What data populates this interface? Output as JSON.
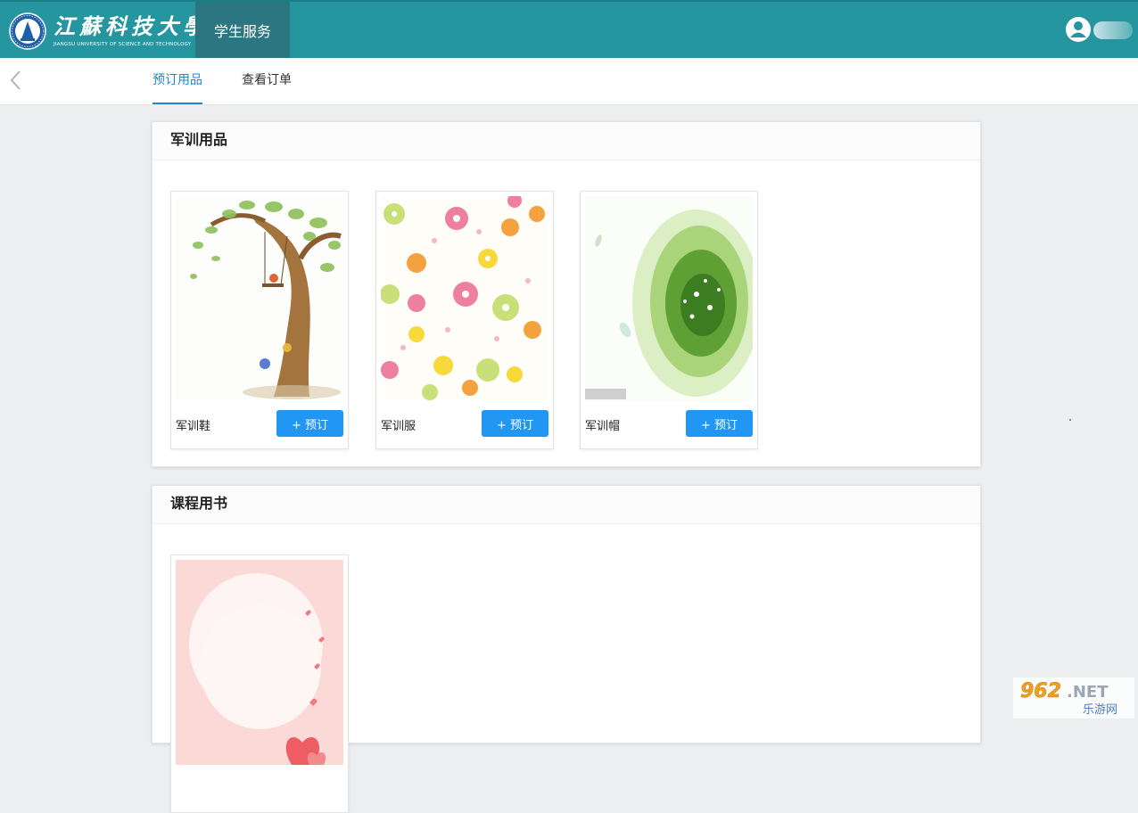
{
  "header": {
    "logo_cn": "江蘇科技大學",
    "logo_en": "JIANGSU UNIVERSITY OF SCIENCE AND TECHNOLOGY",
    "nav_item": "学生服务"
  },
  "tabs": [
    {
      "label": "预订用品",
      "active": true
    },
    {
      "label": "查看订单",
      "active": false
    }
  ],
  "sections": [
    {
      "title": "军训用品",
      "items": [
        {
          "name": "军训鞋",
          "button": "+ 预订"
        },
        {
          "name": "军训服",
          "button": "+ 预订"
        },
        {
          "name": "军训帽",
          "button": "+ 预订"
        }
      ]
    },
    {
      "title": "课程用书",
      "items": [
        {
          "name": ""
        }
      ]
    }
  ],
  "watermark": {
    "top": "962.NET",
    "bottom": "乐游网"
  },
  "colors": {
    "header": "#2596a0",
    "nav_active": "#2b7680",
    "accent": "#1e88c8",
    "button": "#2196f3"
  }
}
